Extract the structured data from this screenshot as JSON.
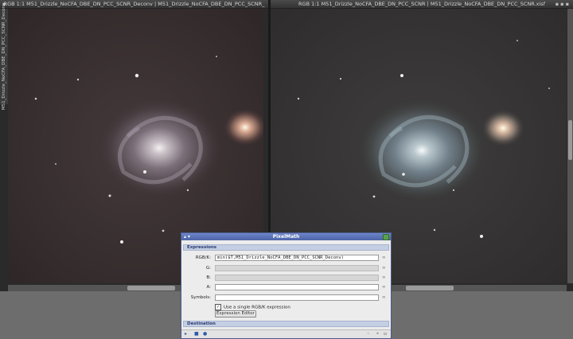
{
  "left_window": {
    "title": "RGB 1:1 M51_Drizzle_NoCFA_DBE_DN_PCC_SCNR_Deconv | M51_Drizzle_NoCFA_DBE_DN_PCC_SCNR_",
    "side_tab": "M51_Drizzle_NoCFA_DBE_DN_PCC_SCNR_Deconv"
  },
  "right_window": {
    "title": "RGB 1:1 M51_Drizzle_NoCFA_DBE_DN_PCC_SCNR | M51_Drizzle_NoCFA_DBE_DN_PCC_SCNR.xisf"
  },
  "pixelmath": {
    "title": "PixelMath",
    "expressions_section": "Expressions",
    "rgbk_label": "RGB/K:",
    "rgbk_value": "min($T,M51_Drizzle_NoCFA_DBE_DN_PCC_SCNR_Deconv)",
    "g_label": "G:",
    "b_label": "B:",
    "a_label": "A:",
    "symbols_label": "Symbols:",
    "edit_glyph": "∞",
    "single_expr_label": "Use a single RGB/K expression",
    "single_expr_checked": "✓",
    "expression_editor_button": "Expression Editor",
    "destination_section": "Destination"
  }
}
